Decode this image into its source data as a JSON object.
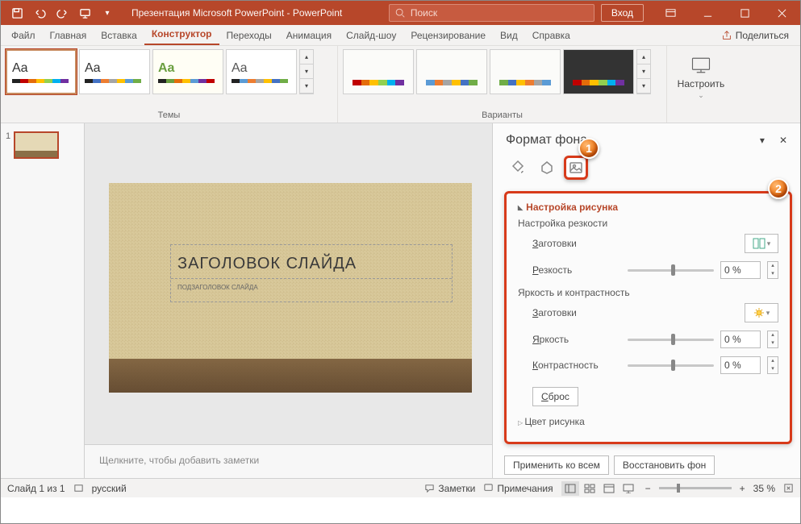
{
  "title": "Презентация Microsoft PowerPoint - PowerPoint",
  "search_placeholder": "Поиск",
  "signin": "Вход",
  "tabs": {
    "file": "Файл",
    "home": "Главная",
    "insert": "Вставка",
    "design": "Конструктор",
    "trans": "Переходы",
    "anim": "Анимация",
    "show": "Слайд-шоу",
    "review": "Рецензирование",
    "view": "Вид",
    "help": "Справка"
  },
  "share": "Поделиться",
  "group_themes": "Темы",
  "group_variants": "Варианты",
  "configure": "Настроить",
  "thumb_num": "1",
  "slide_title": "ЗАГОЛОВОК СЛАЙДА",
  "slide_sub": "ПОДЗАГОЛОВОК СЛАЙДА",
  "notes_hint": "Щелкните, чтобы добавить заметки",
  "pane_title": "Формат фона",
  "sec_pic": "Настройка рисунка",
  "sharp_h": "Настройка резкости",
  "presets": "Заготовки",
  "sharpness": "Резкость",
  "bright_h": "Яркость и контрастность",
  "brightness": "Яркость",
  "contrast": "Контрастность",
  "reset": "Сброс",
  "sec_color": "Цвет рисунка",
  "apply_all": "Применить ко всем",
  "restore_bg": "Восстановить фон",
  "val_sharp": "0 %",
  "val_bright": "0 %",
  "val_contrast": "0 %",
  "status_slide": "Слайд 1 из 1",
  "status_lang": "русский",
  "status_notes": "Заметки",
  "status_comments": "Примечания",
  "zoom": "35 %",
  "callout1": "1",
  "callout2": "2"
}
